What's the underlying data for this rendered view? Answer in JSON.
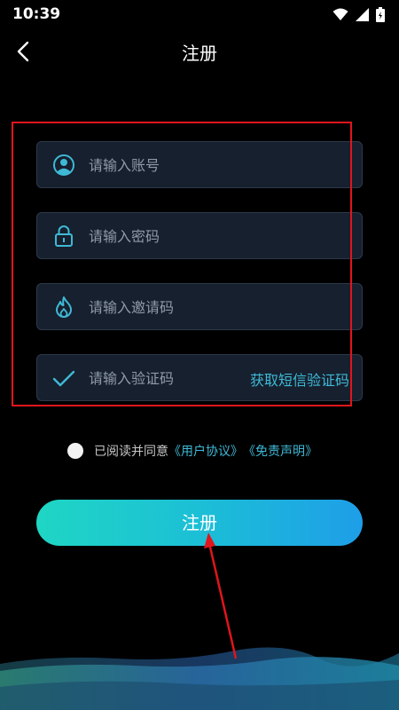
{
  "status": {
    "time": "10:39"
  },
  "nav": {
    "title": "注册"
  },
  "form": {
    "account_placeholder": "请输入账号",
    "password_placeholder": "请输入密码",
    "invite_placeholder": "请输入邀请码",
    "code_placeholder": "请输入验证码",
    "sms_button": "获取短信验证码"
  },
  "agreement": {
    "prefix": "已阅读并同意",
    "user_agreement": "《用户协议》",
    "disclaimer": "《免责声明》"
  },
  "submit": {
    "label": "注册"
  },
  "colors": {
    "accent": "#3fb9d6",
    "field_bg": "#16202e",
    "highlight": "#e0151d",
    "button_start": "#1fd6c4",
    "button_end": "#1e9ee8"
  },
  "icons": [
    "wifi-icon",
    "signal-icon",
    "battery-icon",
    "back-icon",
    "user-icon",
    "lock-icon",
    "flame-icon",
    "check-icon"
  ]
}
